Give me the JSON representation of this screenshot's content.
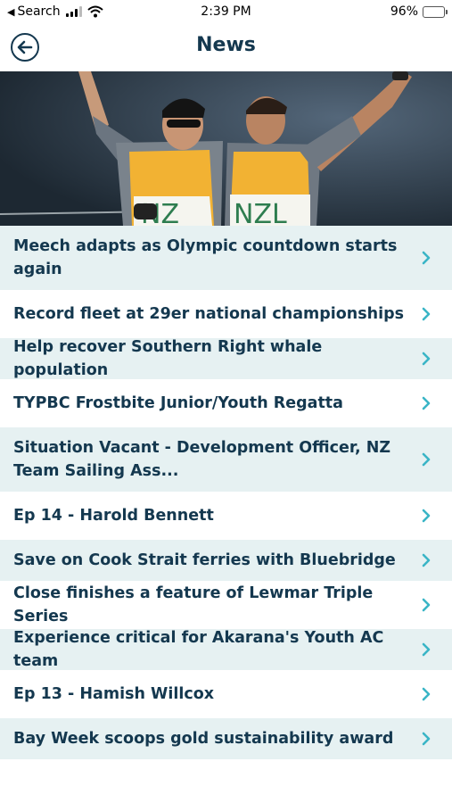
{
  "status_bar": {
    "back_app": "Search",
    "time": "2:39 PM",
    "battery": "96%"
  },
  "nav": {
    "title": "News"
  },
  "hero": {
    "jersey_left": "NZ",
    "jersey_right": "NZL"
  },
  "colors": {
    "primary_text": "#14384f",
    "row_alt_bg": "#e6f1f2",
    "chevron": "#3ab5c6",
    "bib_yellow": "#f2b233"
  },
  "news_items": [
    {
      "title": "Meech adapts as Olympic countdown starts again"
    },
    {
      "title": "Record fleet at 29er national championships"
    },
    {
      "title": "Help recover Southern Right whale population"
    },
    {
      "title": "TYPBC Frostbite Junior/Youth Regatta"
    },
    {
      "title": "Situation Vacant - Development Officer, NZ Team Sailing Ass..."
    },
    {
      "title": "Ep 14 - Harold Bennett"
    },
    {
      "title": "Save on Cook Strait ferries with Bluebridge"
    },
    {
      "title": "Close finishes a feature of Lewmar Triple Series"
    },
    {
      "title": "Experience critical for Akarana's Youth AC team"
    },
    {
      "title": "Ep 13 - Hamish Willcox"
    },
    {
      "title": "Bay Week scoops gold sustainability award"
    }
  ]
}
